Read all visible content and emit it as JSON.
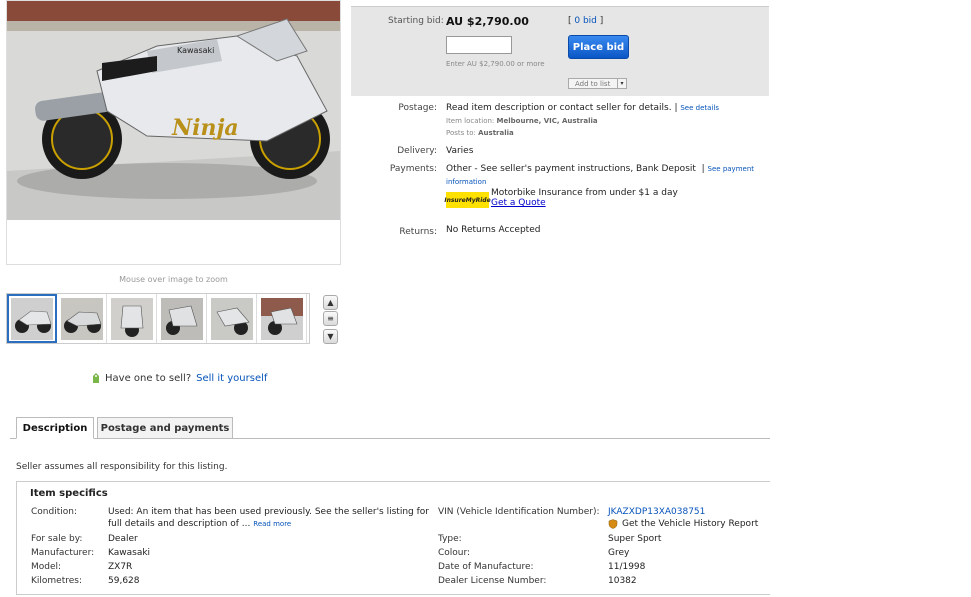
{
  "gallery": {
    "zoom_hint": "Mouse over image to zoom",
    "thumbnails": [
      "thumb-1",
      "thumb-2",
      "thumb-3",
      "thumb-4",
      "thumb-5",
      "thumb-6"
    ],
    "sell_prompt": "Have one to sell?",
    "sell_link": "Sell it yourself"
  },
  "bid": {
    "starting_label": "Starting bid:",
    "starting_price": "AU $2,790.00",
    "bid_count": "0 bid",
    "place_bid": "Place bid",
    "hint": "Enter AU $2,790.00 or more",
    "add_to_list": "Add to list"
  },
  "details": {
    "postage_label": "Postage:",
    "postage_text": "Read item description or contact seller for details.",
    "postage_link": "See details",
    "location_label": "Item location:",
    "location": "Melbourne, VIC, Australia",
    "posts_label": "Posts to:",
    "posts_to": "Australia",
    "delivery_label": "Delivery:",
    "delivery": "Varies",
    "payments_label": "Payments:",
    "payments": "Other - See seller's payment instructions,  Bank Deposit",
    "payments_link_1": "See payment",
    "payments_link_2": "information",
    "insure_logo": "InsureMyRide",
    "insure_text": "Motorbike Insurance from under $1 a day",
    "insure_link": "Get a Quote",
    "returns_label": "Returns:",
    "returns": "No Returns Accepted"
  },
  "tabs": {
    "description": "Description",
    "postage": "Postage and payments"
  },
  "seller_note": "Seller assumes all responsibility for this listing.",
  "specifics": {
    "title": "Item specifics",
    "condition_label": "Condition:",
    "condition_1": "Used: An item that has been used previously. See the seller's listing for",
    "condition_2": "full details and description of ...",
    "read_more": "Read more",
    "vin_label": "VIN (Vehicle Identification Number):",
    "vin": "JKAZXDP13XA038751",
    "history_report": "Get the Vehicle History Report",
    "left": [
      {
        "label": "For sale by:",
        "value": "Dealer"
      },
      {
        "label": "Manufacturer:",
        "value": "Kawasaki"
      },
      {
        "label": "Model:",
        "value": "ZX7R"
      },
      {
        "label": "Kilometres:",
        "value": "59,628"
      }
    ],
    "right": [
      {
        "label": "Type:",
        "value": "Super Sport"
      },
      {
        "label": "Colour:",
        "value": "Grey"
      },
      {
        "label": "Date of Manufacture:",
        "value": "11/1998"
      },
      {
        "label": "Dealer License Number:",
        "value": "10382"
      }
    ]
  },
  "colors": {
    "link": "#0654ba",
    "button": "#0b56c6",
    "bid_box": "#e6e6e6",
    "insure": "#ffe100"
  }
}
